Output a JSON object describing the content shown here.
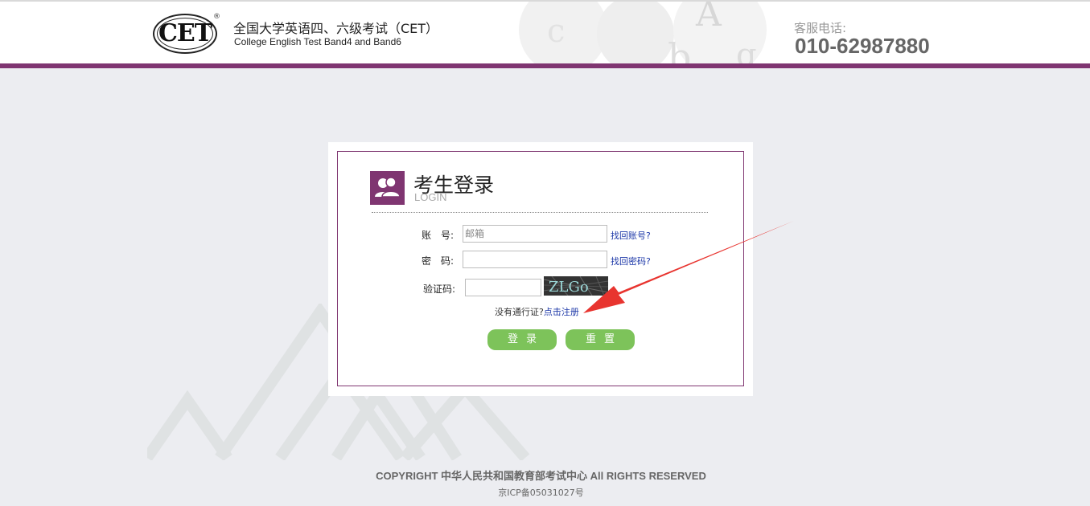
{
  "header": {
    "logo_text": "CET",
    "logo_mark": "®",
    "title": "全国大学英语四、六级考试（CET）",
    "subtitle": "College English Test Band4 and Band6",
    "hotline_label": "客服电话:",
    "hotline_number": "010-62987880",
    "accent_color": "#7f3571"
  },
  "login": {
    "title": "考生登录",
    "subtitle": "LOGIN",
    "icon": "users-icon",
    "account_label": "账　号:",
    "account_placeholder": "邮箱",
    "account_value": "",
    "find_account_link": "找回账号?",
    "password_label": "密　码:",
    "password_value": "",
    "find_password_link": "找回密码?",
    "captcha_label": "验证码:",
    "captcha_value": "",
    "captcha_text": "ZLGo",
    "register_prompt": "没有通行证?",
    "register_link": "点击注册",
    "login_button": "登录",
    "reset_button": "重置",
    "button_color": "#7dc35a"
  },
  "footer": {
    "copyright": "COPYRIGHT 中华人民共和国教育部考试中心 All RIGHTS RESERVED",
    "icp": "京ICP备05031027号"
  }
}
